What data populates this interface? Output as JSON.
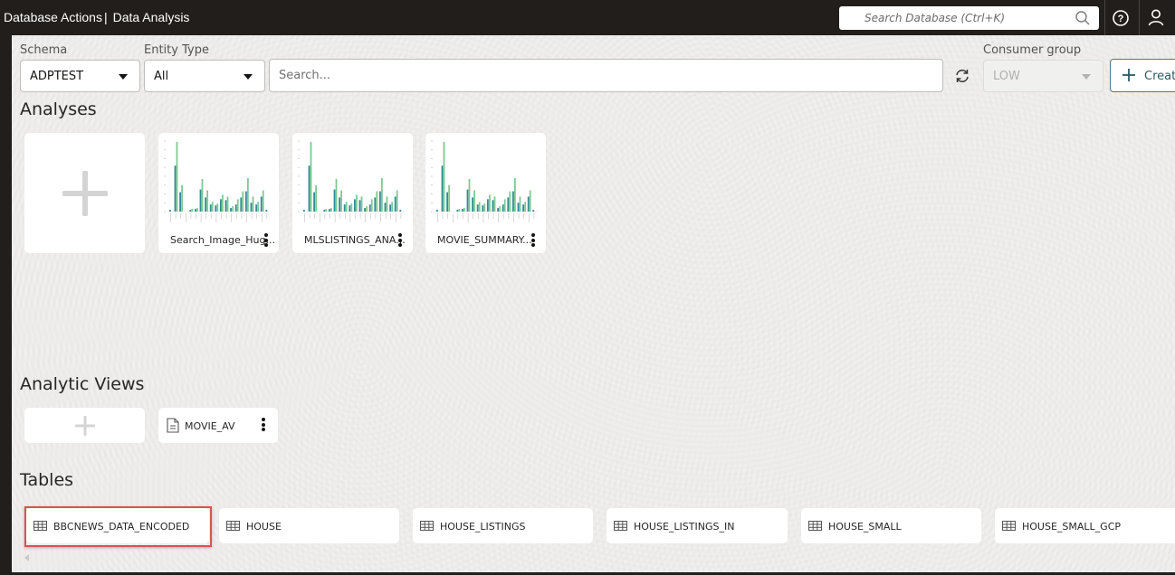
{
  "header": {
    "app_name": "Database Actions",
    "separator": "|",
    "page_name": "Data Analysis",
    "global_search_placeholder": "Search Database (Ctrl+K)",
    "icons": [
      "search-icon",
      "help-icon",
      "user-icon"
    ]
  },
  "filters": {
    "schema": {
      "label": "Schema",
      "value": "ADPTEST"
    },
    "entity_type": {
      "label": "Entity Type",
      "value": "All"
    },
    "search_placeholder": "Search...",
    "consumer_group": {
      "label": "Consumer group",
      "value": "LOW",
      "disabled": true
    },
    "create_label": "Create"
  },
  "analyses": {
    "title": "Analyses",
    "items": [
      {
        "name": "Search_Image_Hug...",
        "thumbnail": "bar-chart"
      },
      {
        "name": "MLSLISTINGS_ANA...",
        "thumbnail": "bar-chart"
      },
      {
        "name": "MOVIE_SUMMARY...",
        "thumbnail": "bar-chart"
      }
    ],
    "thumbnail_series": {
      "primary": [
        2,
        52,
        22,
        0,
        2,
        3,
        25,
        16,
        8,
        7,
        14,
        13,
        4,
        8,
        16,
        23,
        10,
        8,
        17,
        2
      ],
      "secondary": [
        0,
        79,
        30,
        0,
        3,
        4,
        37,
        24,
        11,
        9,
        19,
        17,
        6,
        14,
        23,
        38,
        17,
        11,
        24,
        0
      ],
      "colors": {
        "primary": "#2e8c95",
        "secondary": "#7fc994"
      }
    }
  },
  "analytic_views": {
    "title": "Analytic Views",
    "items": [
      {
        "name": "MOVIE_AV",
        "icon": "document-icon"
      }
    ]
  },
  "tables": {
    "title": "Tables",
    "items": [
      {
        "name": "BBCNEWS_DATA_ENCODED",
        "highlighted": true
      },
      {
        "name": "HOUSE"
      },
      {
        "name": "HOUSE_LISTINGS"
      },
      {
        "name": "HOUSE_LISTINGS_IN"
      },
      {
        "name": "HOUSE_SMALL"
      },
      {
        "name": "HOUSE_SMALL_GCP"
      }
    ]
  },
  "colors": {
    "header_bg": "#221e1b",
    "content_bg": "#f1f0ee",
    "create_border": "#4a7b8d",
    "highlight": "#d9534f"
  }
}
